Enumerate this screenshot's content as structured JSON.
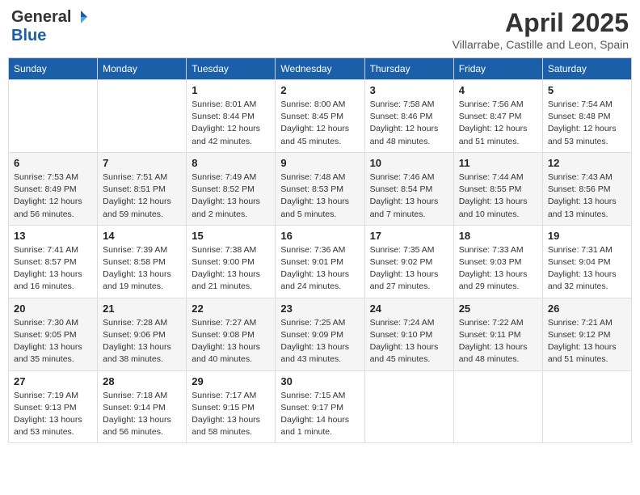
{
  "header": {
    "logo_general": "General",
    "logo_blue": "Blue",
    "month": "April 2025",
    "location": "Villarrabe, Castille and Leon, Spain"
  },
  "weekdays": [
    "Sunday",
    "Monday",
    "Tuesday",
    "Wednesday",
    "Thursday",
    "Friday",
    "Saturday"
  ],
  "weeks": [
    [
      {
        "day": "",
        "info": ""
      },
      {
        "day": "",
        "info": ""
      },
      {
        "day": "1",
        "info": "Sunrise: 8:01 AM\nSunset: 8:44 PM\nDaylight: 12 hours and 42 minutes."
      },
      {
        "day": "2",
        "info": "Sunrise: 8:00 AM\nSunset: 8:45 PM\nDaylight: 12 hours and 45 minutes."
      },
      {
        "day": "3",
        "info": "Sunrise: 7:58 AM\nSunset: 8:46 PM\nDaylight: 12 hours and 48 minutes."
      },
      {
        "day": "4",
        "info": "Sunrise: 7:56 AM\nSunset: 8:47 PM\nDaylight: 12 hours and 51 minutes."
      },
      {
        "day": "5",
        "info": "Sunrise: 7:54 AM\nSunset: 8:48 PM\nDaylight: 12 hours and 53 minutes."
      }
    ],
    [
      {
        "day": "6",
        "info": "Sunrise: 7:53 AM\nSunset: 8:49 PM\nDaylight: 12 hours and 56 minutes."
      },
      {
        "day": "7",
        "info": "Sunrise: 7:51 AM\nSunset: 8:51 PM\nDaylight: 12 hours and 59 minutes."
      },
      {
        "day": "8",
        "info": "Sunrise: 7:49 AM\nSunset: 8:52 PM\nDaylight: 13 hours and 2 minutes."
      },
      {
        "day": "9",
        "info": "Sunrise: 7:48 AM\nSunset: 8:53 PM\nDaylight: 13 hours and 5 minutes."
      },
      {
        "day": "10",
        "info": "Sunrise: 7:46 AM\nSunset: 8:54 PM\nDaylight: 13 hours and 7 minutes."
      },
      {
        "day": "11",
        "info": "Sunrise: 7:44 AM\nSunset: 8:55 PM\nDaylight: 13 hours and 10 minutes."
      },
      {
        "day": "12",
        "info": "Sunrise: 7:43 AM\nSunset: 8:56 PM\nDaylight: 13 hours and 13 minutes."
      }
    ],
    [
      {
        "day": "13",
        "info": "Sunrise: 7:41 AM\nSunset: 8:57 PM\nDaylight: 13 hours and 16 minutes."
      },
      {
        "day": "14",
        "info": "Sunrise: 7:39 AM\nSunset: 8:58 PM\nDaylight: 13 hours and 19 minutes."
      },
      {
        "day": "15",
        "info": "Sunrise: 7:38 AM\nSunset: 9:00 PM\nDaylight: 13 hours and 21 minutes."
      },
      {
        "day": "16",
        "info": "Sunrise: 7:36 AM\nSunset: 9:01 PM\nDaylight: 13 hours and 24 minutes."
      },
      {
        "day": "17",
        "info": "Sunrise: 7:35 AM\nSunset: 9:02 PM\nDaylight: 13 hours and 27 minutes."
      },
      {
        "day": "18",
        "info": "Sunrise: 7:33 AM\nSunset: 9:03 PM\nDaylight: 13 hours and 29 minutes."
      },
      {
        "day": "19",
        "info": "Sunrise: 7:31 AM\nSunset: 9:04 PM\nDaylight: 13 hours and 32 minutes."
      }
    ],
    [
      {
        "day": "20",
        "info": "Sunrise: 7:30 AM\nSunset: 9:05 PM\nDaylight: 13 hours and 35 minutes."
      },
      {
        "day": "21",
        "info": "Sunrise: 7:28 AM\nSunset: 9:06 PM\nDaylight: 13 hours and 38 minutes."
      },
      {
        "day": "22",
        "info": "Sunrise: 7:27 AM\nSunset: 9:08 PM\nDaylight: 13 hours and 40 minutes."
      },
      {
        "day": "23",
        "info": "Sunrise: 7:25 AM\nSunset: 9:09 PM\nDaylight: 13 hours and 43 minutes."
      },
      {
        "day": "24",
        "info": "Sunrise: 7:24 AM\nSunset: 9:10 PM\nDaylight: 13 hours and 45 minutes."
      },
      {
        "day": "25",
        "info": "Sunrise: 7:22 AM\nSunset: 9:11 PM\nDaylight: 13 hours and 48 minutes."
      },
      {
        "day": "26",
        "info": "Sunrise: 7:21 AM\nSunset: 9:12 PM\nDaylight: 13 hours and 51 minutes."
      }
    ],
    [
      {
        "day": "27",
        "info": "Sunrise: 7:19 AM\nSunset: 9:13 PM\nDaylight: 13 hours and 53 minutes."
      },
      {
        "day": "28",
        "info": "Sunrise: 7:18 AM\nSunset: 9:14 PM\nDaylight: 13 hours and 56 minutes."
      },
      {
        "day": "29",
        "info": "Sunrise: 7:17 AM\nSunset: 9:15 PM\nDaylight: 13 hours and 58 minutes."
      },
      {
        "day": "30",
        "info": "Sunrise: 7:15 AM\nSunset: 9:17 PM\nDaylight: 14 hours and 1 minute."
      },
      {
        "day": "",
        "info": ""
      },
      {
        "day": "",
        "info": ""
      },
      {
        "day": "",
        "info": ""
      }
    ]
  ]
}
